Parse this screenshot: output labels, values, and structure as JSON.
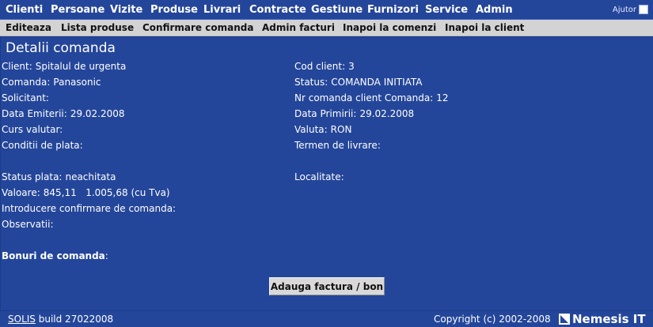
{
  "top_menu": [
    "Clienti",
    "Persoane",
    "Vizite",
    "Produse",
    "Livrari",
    "Contracte",
    "Gestiune",
    "Furnizori",
    "Service",
    "Admin"
  ],
  "help_label": "Ajutor",
  "sub_menu": [
    "Editeaza",
    "Lista produse",
    "Confirmare comanda",
    "Admin facturi",
    "Inapoi la comenzi",
    "Inapoi la client"
  ],
  "panel_title": "Detalii comanda",
  "left_fields": [
    {
      "label": "Client:",
      "value": "Spitalul de urgenta"
    },
    {
      "label": "Comanda:",
      "value": "Panasonic"
    },
    {
      "label": "Solicitant:",
      "value": ""
    },
    {
      "label": "Data Emiterii:",
      "value": "29.02.2008"
    },
    {
      "label": "Curs valutar:",
      "value": ""
    },
    {
      "label": "Conditii de plata:",
      "value": ""
    },
    {
      "label": "Status plata:",
      "value": "neachitata"
    },
    {
      "label": "Valoare:",
      "value": "845,11   1.005,68 (cu Tva)"
    },
    {
      "label": "Introducere confirmare de comanda:",
      "value": ""
    },
    {
      "label": "Observatii:",
      "value": ""
    }
  ],
  "right_fields": [
    {
      "label": "Cod client:",
      "value": "3"
    },
    {
      "label": "Status:",
      "value": "COMANDA INITIATA"
    },
    {
      "label": "Nr comanda client Comanda:",
      "value": "12"
    },
    {
      "label": "Data Primirii:",
      "value": "29.02.2008"
    },
    {
      "label": "Valuta:",
      "value": "RON"
    },
    {
      "label": "Termen de livrare:",
      "value": ""
    },
    {
      "label": "Localitate:",
      "value": ""
    }
  ],
  "vouchers_label": "Bonuri de comanda",
  "vouchers_colon": ":",
  "add_button": "Adauga factura / bon",
  "footer": {
    "product_link": "SOLIS",
    "build": "build 27022008",
    "copyright": "Copyright (c) 2002-2008",
    "brand": "Nemesis IT"
  }
}
